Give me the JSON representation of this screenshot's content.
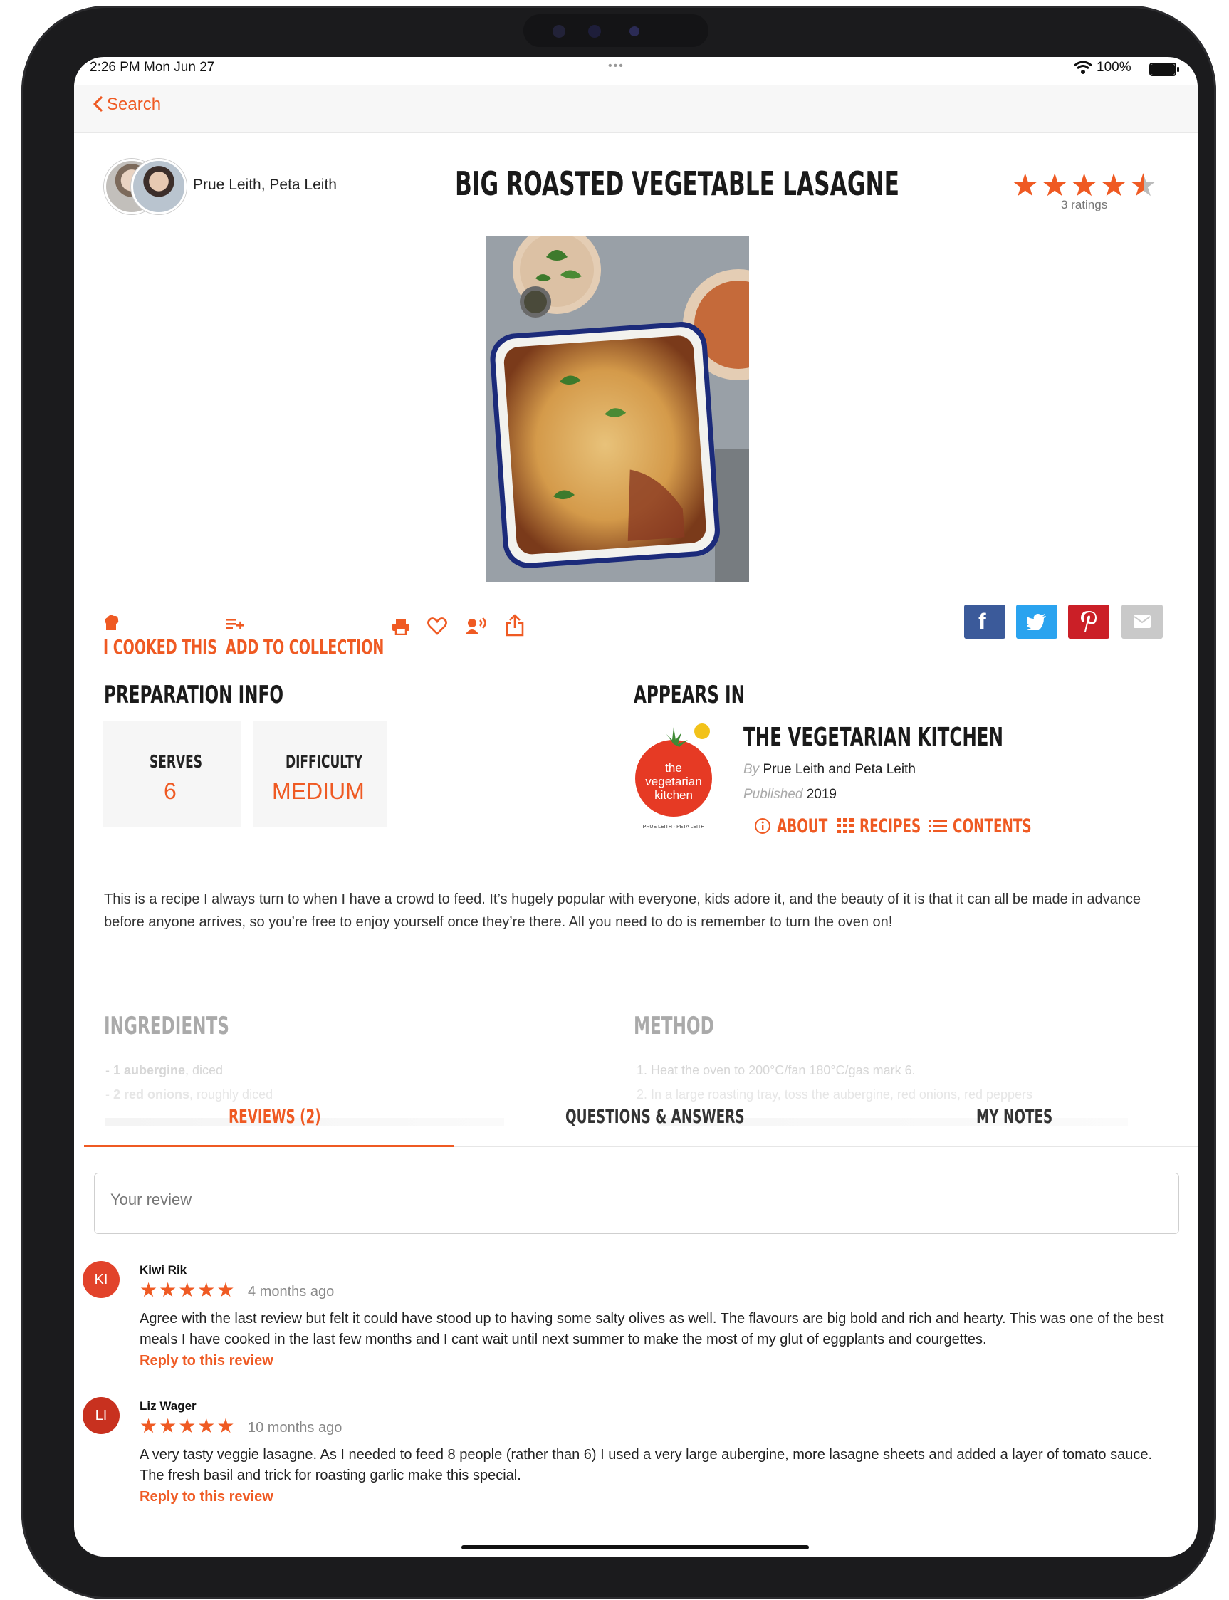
{
  "status_bar": {
    "time": "2:26 PM  Mon Jun 27",
    "dots": "•••",
    "battery": "100%"
  },
  "nav": {
    "back_label": "Search"
  },
  "recipe": {
    "authors": "Prue Leith, Peta Leith",
    "title": "BIG ROASTED VEGETABLE LASAGNE",
    "rating_stars": "★★★★★",
    "rating": 4.5,
    "rating_count": "3 ratings"
  },
  "actions": {
    "cooked_label": "I COOKED THIS",
    "collection_label": "ADD TO COLLECTION",
    "icons": [
      "chef-hat-icon",
      "add-to-collection-icon",
      "print-icon",
      "heart-icon",
      "voice-icon",
      "share-icon"
    ]
  },
  "share": {
    "facebook": "f",
    "social": [
      "facebook",
      "twitter",
      "pinterest",
      "email"
    ],
    "colors": {
      "facebook": "#3b5a9a",
      "twitter": "#2aa3ef",
      "pinterest": "#cb1f27",
      "email": "#c9c9c9"
    }
  },
  "prep": {
    "heading": "PREPARATION INFO",
    "serves_label": "SERVES",
    "serves_value": "6",
    "difficulty_label": "DIFFICULTY",
    "difficulty_value": "MEDIUM"
  },
  "appears_in": {
    "heading": "APPEARS IN",
    "book_title": "THE VEGETARIAN KITCHEN",
    "by_label": "By",
    "by_value": "Prue Leith and Peta Leith",
    "published_label": "Published",
    "published_value": "2019",
    "cover_line1": "the",
    "cover_line2": "vegetarian",
    "cover_line3": "kitchen",
    "cover_authors": "PRUE LEITH · PETA LEITH",
    "about_label": "ABOUT",
    "recipes_label": "RECIPES",
    "contents_label": "CONTENTS"
  },
  "intro": "This is a recipe I always turn to when I have a crowd to feed. It’s hugely popular with everyone, kids adore it, and the beauty of it is that it can all be made in advance before anyone arrives, so you’re free to enjoy yourself once they’re there. All you need to do is remember to turn the oven on!",
  "ingredients": {
    "heading": "INGREDIENTS",
    "items": [
      {
        "bold": "1 aubergine",
        "rest": ", diced"
      },
      {
        "bold": "2 red onions",
        "rest": ", roughly diced"
      }
    ]
  },
  "method": {
    "heading": "METHOD",
    "steps": [
      {
        "num": "1.",
        "text": "Heat the oven to 200°C/fan 180°C/gas mark 6."
      },
      {
        "num": "2.",
        "text": "In a large roasting tray, toss the aubergine, red onions, red peppers"
      }
    ]
  },
  "tabs": {
    "reviews": "REVIEWS (2)",
    "qa": "QUESTIONS & ANSWERS",
    "notes": "MY NOTES",
    "active": "reviews"
  },
  "review_input": {
    "placeholder": "Your review"
  },
  "reviews": [
    {
      "initials": "KI",
      "name": "Kiwi Rik",
      "stars": "★★★★★",
      "rating": 5,
      "date": "4 months ago",
      "text": "Agree with the last review but felt it could have stood up to having some salty olives as well. The flavours are big bold and rich and hearty. This was one of the best meals I have cooked in the last few months and I cant wait until next summer to make the most of my glut of eggplants and courgettes.",
      "reply": "Reply to this review",
      "color": "#e2432b"
    },
    {
      "initials": "LI",
      "name": "Liz Wager",
      "stars": "★★★★★",
      "rating": 5,
      "date": "10 months ago",
      "text": "A very tasty veggie lasagne. As I needed to feed 8 people (rather than 6) I used a very large aubergine, more lasagne sheets and added a layer of tomato sauce. The fresh basil and trick for roasting garlic make this special.",
      "reply": "Reply to this review",
      "color": "#c8311f"
    }
  ],
  "colors": {
    "accent": "#ef5a23"
  }
}
